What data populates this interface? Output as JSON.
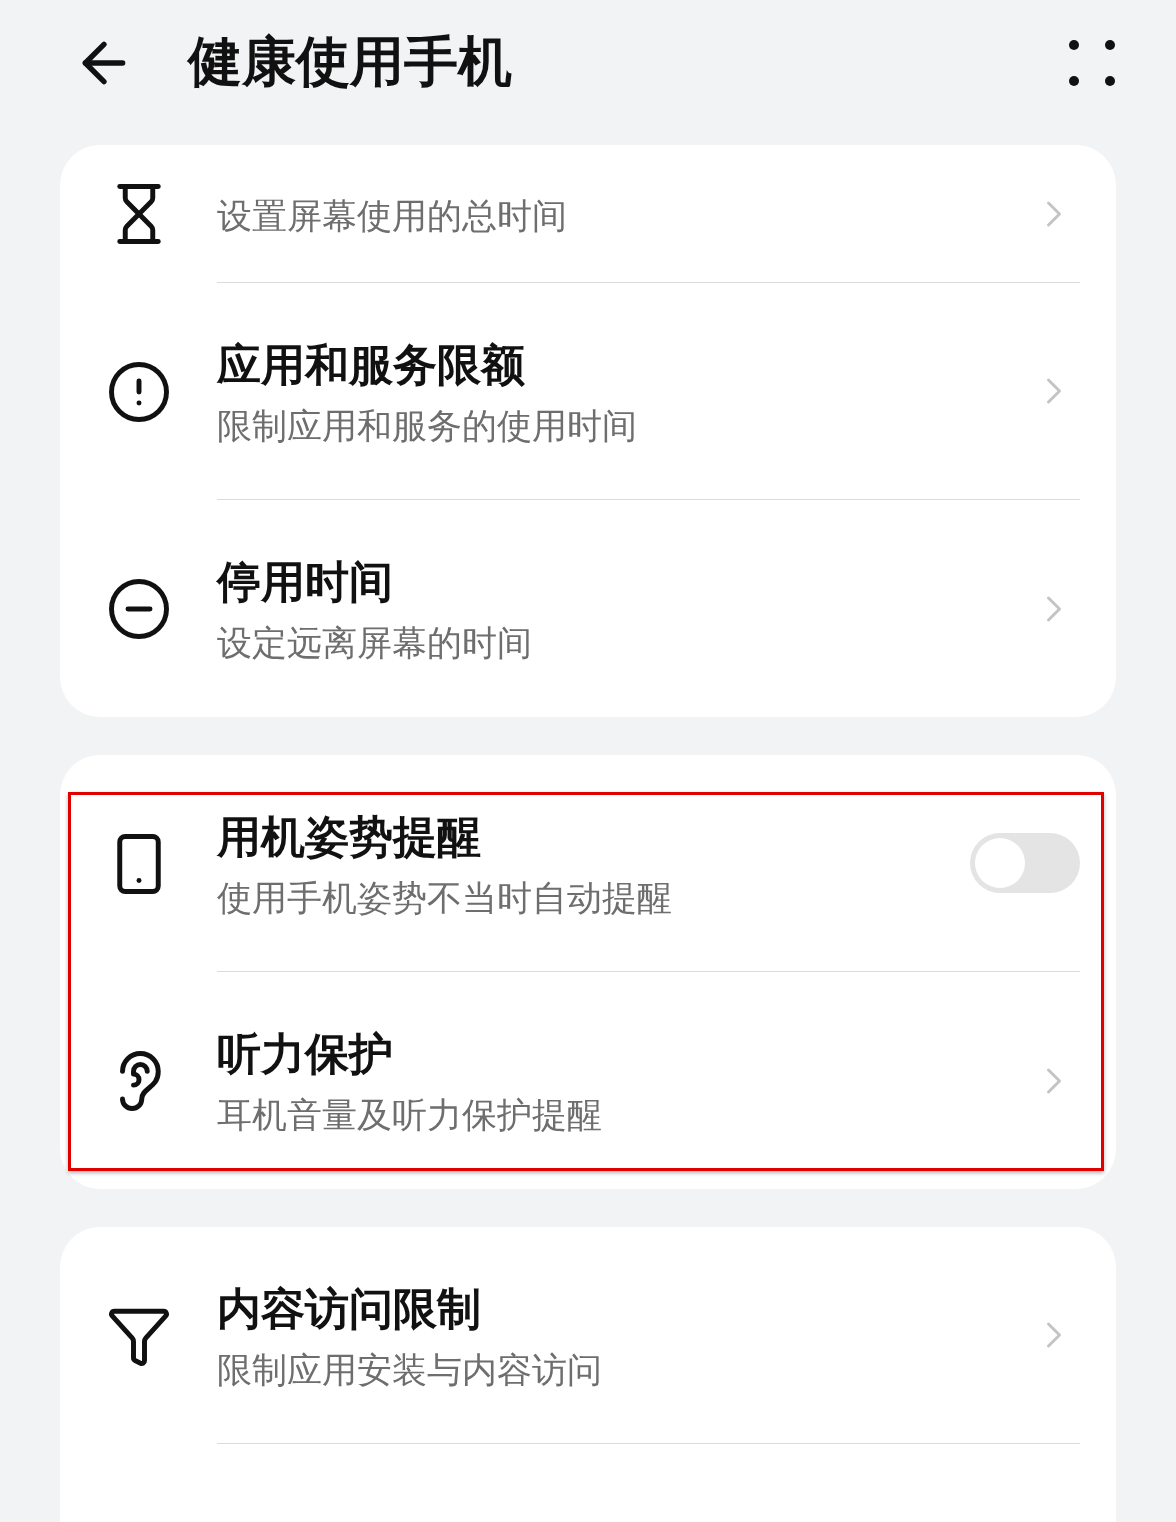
{
  "header": {
    "title": "健康使用手机"
  },
  "groups": [
    {
      "highlighted": false,
      "items": [
        {
          "kind": "nav",
          "subtitle": "设置屏幕使用的总时间"
        },
        {
          "kind": "nav",
          "title": "应用和服务限额",
          "subtitle": "限制应用和服务的使用时间"
        },
        {
          "kind": "nav",
          "title": "停用时间",
          "subtitle": "设定远离屏幕的时间"
        }
      ]
    },
    {
      "highlighted": true,
      "items": [
        {
          "kind": "toggle",
          "title": "用机姿势提醒",
          "subtitle": "使用手机姿势不当时自动提醒",
          "on": false
        },
        {
          "kind": "nav",
          "title": "听力保护",
          "subtitle": "耳机音量及听力保护提醒"
        }
      ]
    },
    {
      "highlighted": false,
      "items": [
        {
          "kind": "nav",
          "title": "内容访问限制",
          "subtitle": "限制应用安装与内容访问"
        }
      ]
    }
  ]
}
